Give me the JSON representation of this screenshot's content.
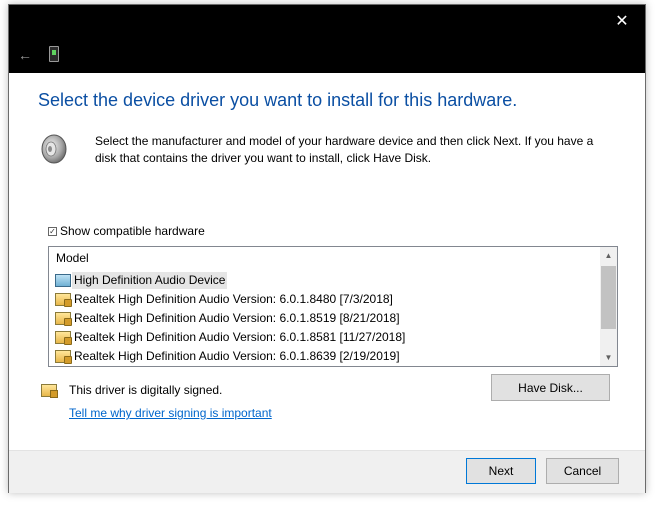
{
  "window": {
    "close_glyph": "✕",
    "back_glyph": "←"
  },
  "heading": "Select the device driver you want to install for this hardware.",
  "instructions": "Select the manufacturer and model of your hardware device and then click Next. If you have a disk that contains the driver you want to install, click Have Disk.",
  "show_compatible": {
    "label": "Show compatible hardware",
    "checked": true
  },
  "model_list": {
    "header": "Model",
    "rows": [
      {
        "label": "High Definition Audio Device",
        "icon": "audio-device-icon",
        "selected": true
      },
      {
        "label": "Realtek High Definition Audio Version: 6.0.1.8480 [7/3/2018]",
        "icon": "signed-driver-icon",
        "selected": false
      },
      {
        "label": "Realtek High Definition Audio Version: 6.0.1.8519 [8/21/2018]",
        "icon": "signed-driver-icon",
        "selected": false
      },
      {
        "label": "Realtek High Definition Audio Version: 6.0.1.8581 [11/27/2018]",
        "icon": "signed-driver-icon",
        "selected": false
      },
      {
        "label": "Realtek High Definition Audio Version: 6.0.1.8639 [2/19/2019]",
        "icon": "signed-driver-icon",
        "selected": false
      }
    ]
  },
  "signed_text": "This driver is digitally signed.",
  "signing_link": "Tell me why driver signing is important",
  "buttons": {
    "have_disk": "Have Disk...",
    "next": "Next",
    "cancel": "Cancel"
  },
  "colors": {
    "heading": "#0b4fa3",
    "link": "#0066cc",
    "accent_border": "#0078d7"
  }
}
